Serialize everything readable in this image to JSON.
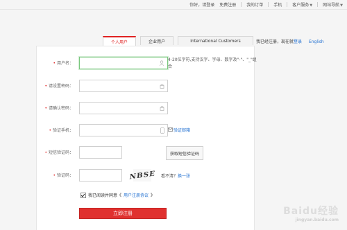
{
  "topnav": {
    "items": [
      "你好，请登录",
      "免费注册",
      "我的订单",
      "手机",
      "客户服务",
      "网站导航"
    ]
  },
  "tabs": [
    {
      "label": "个人用户"
    },
    {
      "label": "企业用户"
    },
    {
      "label": "International Customers"
    }
  ],
  "login_hint": {
    "prefix": "我已经注册，现在就",
    "link": "登录",
    "english": "English"
  },
  "form": {
    "username": {
      "label": "用户名：",
      "hint": "4-20位字符,支持汉字、字母、数字及\"-\"、\"_\"组合"
    },
    "password": {
      "label": "请设置密码："
    },
    "confirm": {
      "label": "请确认密码："
    },
    "phone": {
      "label": "验证手机：",
      "mail_link": "验证邮箱"
    },
    "sms": {
      "label": "短信验证码：",
      "button": "获取短信验证码"
    },
    "captcha": {
      "label": "验证码：",
      "image_text": "NBSE",
      "refresh_prefix": "看不清？",
      "refresh_link": "换一张"
    },
    "agree": {
      "text": "我已阅读并同意《",
      "link": "用户注册协议",
      "suffix": "》"
    },
    "submit": "立即注册"
  },
  "watermark": {
    "text": "Baidu经验",
    "sub": "jingyan.baidu.com"
  },
  "colors": {
    "accent": "#e02222",
    "link": "#1f6fd1"
  }
}
